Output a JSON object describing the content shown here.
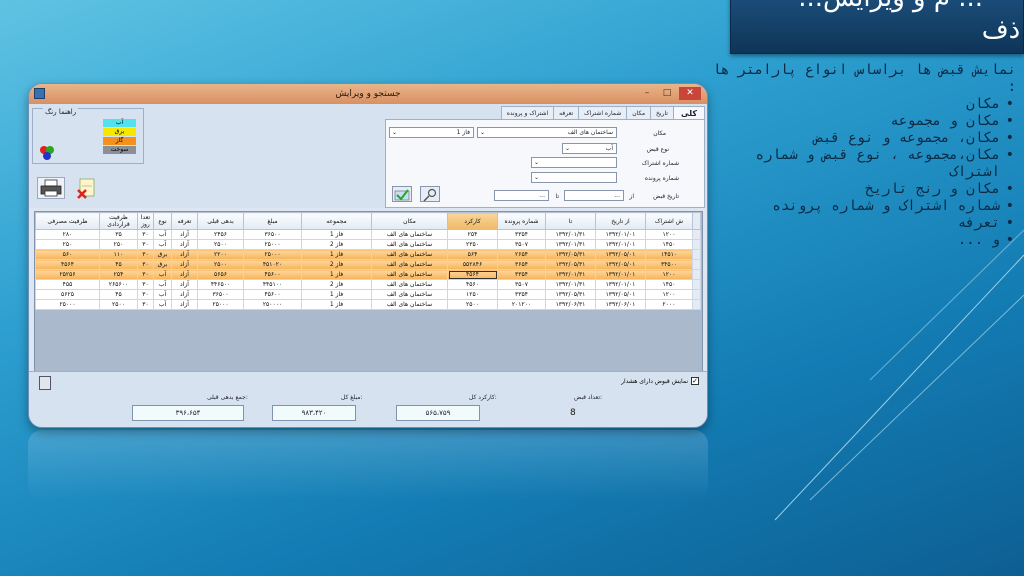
{
  "slide": {
    "title_line1": "...م و ویرایش ...",
    "title_line2": "ذف:",
    "intro": "نمایش قبض ها براساس انواع پارامتر ها :",
    "bullets": [
      "مکان",
      "مکان و مجموعه",
      "مکان، مجموعه و نوع قبض",
      "مکان،مجموعه ، نوع قبض و شماره اشتراک",
      "مکان و رنج تاریخ",
      "شماره اشتراک و شماره پرونده",
      "تعرفه",
      "و ..."
    ]
  },
  "window": {
    "title": "جستجو و ویرایش",
    "controls": {
      "minimize": "–",
      "maximize": "□",
      "close": "✕"
    }
  },
  "legend": {
    "title": "راهنما رنگ",
    "items": [
      {
        "label": "آب",
        "color": "#4fe3f0"
      },
      {
        "label": "برق",
        "color": "#f7e600"
      },
      {
        "label": "گاز",
        "color": "#f2911b"
      },
      {
        "label": "سوخت",
        "color": "#8a8f98"
      }
    ]
  },
  "tabs": [
    "کلی",
    "تاریخ",
    "مکان",
    "شماره اشتراک",
    "تعرفه",
    "اشتراک و پرونده"
  ],
  "filters": {
    "place_label": "مکان",
    "place_value": "ساختمان های الف",
    "collection_value": "فاز 1",
    "bill_type_label": "نوع قبض",
    "bill_type_value": "آب",
    "subscription_label": "شماره اشتراک",
    "file_label": "شماره پرونده",
    "date_label": "تاریخ قبض",
    "from_label": "از",
    "to_label": "تا",
    "date_from": "...",
    "date_to": "..."
  },
  "table": {
    "columns": [
      "ش اشتراک",
      "از تاریخ",
      "تا",
      "شماره پرونده",
      "کارکرد",
      "مکان",
      "مجموعه",
      "مبلغ",
      "بدهی قبلی",
      "تعرفه",
      "نوع",
      "تعدا روز",
      "ظرفیت قراردادی",
      "ظرفیت مصرفی"
    ],
    "rows": [
      {
        "hl": false,
        "cells": [
          "۱۲۰۰",
          "۱۳۹۲/۰۱/۰۱",
          "۱۳۹۲/۰۱/۳۱",
          "۳۳۵۴",
          "۲۵۴",
          "ساختمان های الف",
          "فاز 1",
          "۳۶۵۰۰",
          "۲۴۵۶",
          "آزاد",
          "آب",
          "۳۰",
          "۳۵",
          "۲۸۰"
        ]
      },
      {
        "hl": false,
        "cells": [
          "۱۴۵۰",
          "۱۳۹۲/۰۱/۰۱",
          "۱۳۹۲/۰۱/۳۱",
          "۳۵۰۷",
          "۲۳۵۰",
          "ساختمان های الف",
          "فاز 2",
          "۲۵۰۰۰",
          "۲۵۰۰",
          "آزاد",
          "آب",
          "۳۰",
          "۲۵۰",
          "۲۵۰"
        ]
      },
      {
        "hl": true,
        "cells": [
          "۱۴۵۱۰",
          "۱۳۹۲/۰۵/۰۱",
          "۱۳۹۲/۰۵/۳۱",
          "۲۶۵۴",
          "۵۶۴",
          "ساختمان های الف",
          "فاز 1",
          "۲۵۰۰۰",
          "۲۲۰۰",
          "آزاد",
          "برق",
          "۳۰",
          "۱۱۰",
          "۵۶۰"
        ]
      },
      {
        "hl": true,
        "cells": [
          "۳۴۵۰۰",
          "۱۳۹۲/۰۵/۰۱",
          "۱۳۹۲/۰۵/۳۱",
          "۳۶۵۴",
          "۵۵۲۸۴۶",
          "ساختمان های الف",
          "فاز 2",
          "۴۵۱۰۲۰",
          "۲۵۰۰",
          "آزاد",
          "برق",
          "۳۰",
          "۴۵",
          "۴۵۶۴"
        ]
      },
      {
        "hl": true,
        "sel": 4,
        "cells": [
          "۱۲۰۰",
          "۱۳۹۲/۰۱/۰۱",
          "۱۳۹۲/۰۱/۳۱",
          "۳۳۵۴",
          "۴۵۶۴",
          "ساختمان های الف",
          "فاز 1",
          "۴۵۶۰۰",
          "۵۶۵۶",
          "آزاد",
          "آب",
          "۳۰",
          "۲۵۴",
          "۲۵۲۵۶"
        ]
      },
      {
        "hl": false,
        "cells": [
          "۱۴۵۰",
          "۱۳۹۲/۰۱/۰۱",
          "۱۳۹۲/۰۱/۳۱",
          "۳۵۰۷",
          "۴۵۶۰",
          "ساختمان های الف",
          "فاز 2",
          "۴۴۵۱۰۰",
          "۴۴۶۵۰۰",
          "آزاد",
          "آب",
          "۳۰",
          "۲۶۵۶۰۰",
          "۴۵۵"
        ]
      },
      {
        "hl": false,
        "cells": [
          "۱۲۰۰",
          "۱۳۹۲/۰۵/۰۱",
          "۱۳۹۲/۰۵/۳۱",
          "۳۳۵۴",
          "۱۲۵۰",
          "ساختمان های الف",
          "فاز 1",
          "۴۵۶۰۰",
          "۳۶۵۰۰",
          "آزاد",
          "آب",
          "۳۰",
          "۴۵",
          "۵۶۲۵"
        ]
      },
      {
        "hl": false,
        "cells": [
          "۲۰۰۰",
          "۱۳۹۲/۰۶/۰۱",
          "۱۳۹۲/۰۶/۳۱",
          "۲۰۱۲۰۰",
          "۲۵۰۰",
          "ساختمان های الف",
          "فاز 1",
          "۲۵۰۰۰۰",
          "۲۵۰۰۰",
          "آزاد",
          "آب",
          "۳۰",
          "۲۵۰۰",
          "۲۵۰۰۰"
        ]
      }
    ]
  },
  "footer": {
    "warning_checkbox": "نمایش قبوض دارای هشدار",
    "count_label": "تعداد قبض:",
    "count_value": "8",
    "usage_label": "کارکرد کل:",
    "usage_value": "۵۶۵،۷۵۹",
    "amount_label": "مبلغ کل:",
    "amount_value": "۹۸۳،۴۲۰",
    "debt_label": "جمع بدهی قبلی:",
    "debt_value": "۳۹۶،۶۵۴"
  }
}
